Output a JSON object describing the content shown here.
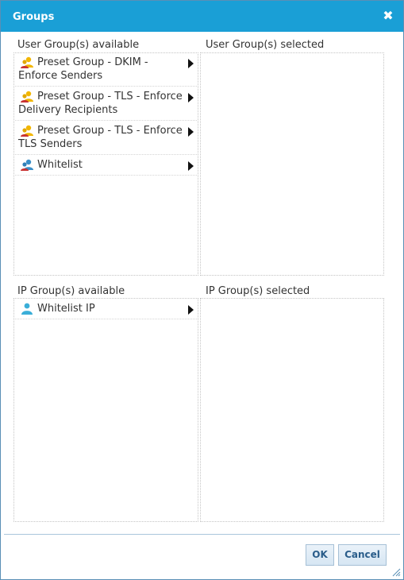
{
  "dialog": {
    "title": "Groups",
    "close_glyph": "✖"
  },
  "user_groups": {
    "available_label": "User Group(s) available",
    "selected_label": "User Group(s) selected",
    "available_items": [
      {
        "label": "Preset Group - DKIM - Enforce Senders",
        "icon": "user-group-icon"
      },
      {
        "label": "Preset Group - TLS - Enforce Delivery Recipients",
        "icon": "user-group-icon"
      },
      {
        "label": "Preset Group - TLS - Enforce TLS Senders",
        "icon": "user-group-icon"
      },
      {
        "label": "Whitelist",
        "icon": "user-group-whitelist-icon"
      }
    ],
    "selected_items": []
  },
  "ip_groups": {
    "available_label": "IP Group(s) available",
    "selected_label": "IP Group(s) selected",
    "available_items": [
      {
        "label": "Whitelist IP",
        "icon": "ip-group-icon"
      }
    ],
    "selected_items": []
  },
  "footer": {
    "ok_label": "OK",
    "cancel_label": "Cancel"
  },
  "colors": {
    "titlebar": "#1a9fd6",
    "button_text": "#2a5d8a"
  }
}
